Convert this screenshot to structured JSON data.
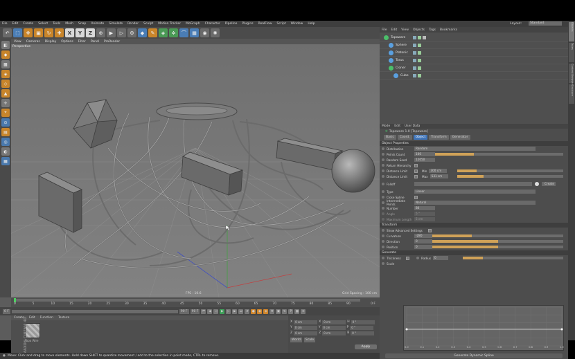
{
  "menubar": {
    "items": [
      "File",
      "Edit",
      "Create",
      "Select",
      "Tools",
      "Mesh",
      "Snap",
      "Animate",
      "Simulate",
      "Render",
      "Sculpt",
      "Motion Tracker",
      "MoGraph",
      "Character",
      "Pipeline",
      "Plugins",
      "RealFlow",
      "Script",
      "Window",
      "Help"
    ],
    "layout_label": "Layout:",
    "layout_value": "Standard"
  },
  "toolbar": {
    "icons": [
      "undo-icon",
      "select-icon",
      "move-icon",
      "scale-icon",
      "rotate-icon",
      "last-tool-icon",
      "x-axis-icon",
      "y-axis-icon",
      "z-axis-icon",
      "world-coord-icon",
      "render-view-icon",
      "render-pv-icon",
      "render-settings-icon",
      "cube-icon",
      "pen-icon",
      "subdivide-icon",
      "cloner-icon",
      "deformer-icon",
      "scene-icon",
      "camera-icon",
      "light-icon"
    ],
    "axis_labels": [
      "X",
      "Y",
      "Z"
    ]
  },
  "viewport": {
    "menu": [
      "View",
      "Cameras",
      "Display",
      "Options",
      "Filter",
      "Panel",
      "ProRender"
    ],
    "label": "Perspective",
    "fps": "FPS : 10.6",
    "grid_spacing": "Grid Spacing : 100 cm"
  },
  "timeline": {
    "ticks": [
      "0",
      "5",
      "10",
      "15",
      "20",
      "25",
      "30",
      "35",
      "40",
      "45",
      "50",
      "55",
      "60",
      "65",
      "70",
      "75",
      "80",
      "85",
      "90"
    ],
    "end_frame": "0 F",
    "start_field": "0 F",
    "end_field": "90 F",
    "max_field": "90 F"
  },
  "material_manager": {
    "menu": [
      "Create",
      "Edit",
      "Function",
      "Texture"
    ],
    "material_name": "Topo Wire",
    "logo": "MAXON CINEMA 4D"
  },
  "coordinates": {
    "rows": [
      {
        "a": "X",
        "b": "0 cm",
        "c": "X",
        "d": "0 cm",
        "e": "H",
        "f": "0 °"
      },
      {
        "a": "Y",
        "b": "0 cm",
        "c": "Y",
        "d": "0 cm",
        "e": "P",
        "f": "0 °"
      },
      {
        "a": "Z",
        "b": "0 cm",
        "c": "Z",
        "d": "0 cm",
        "e": "B",
        "f": "0 °"
      }
    ],
    "mode": "World",
    "scale_mode": "Scale",
    "apply": "Apply"
  },
  "status_text": "Move: Click and drag to move elements. Hold down SHIFT to quantize movement / add to the selection in point mode, CTRL to remove.",
  "object_manager": {
    "menu": [
      "File",
      "Edit",
      "View",
      "Objects",
      "Tags",
      "Bookmarks"
    ],
    "objects": [
      {
        "name": "Topoware",
        "indent": 0,
        "color": "#4bbf6a"
      },
      {
        "name": "Sphere",
        "indent": 1,
        "color": "#5aa0e0"
      },
      {
        "name": "Platonic",
        "indent": 1,
        "color": "#5aa0e0"
      },
      {
        "name": "Torus",
        "indent": 1,
        "color": "#5aa0e0"
      },
      {
        "name": "Cloner",
        "indent": 1,
        "color": "#4bbf6a"
      },
      {
        "name": "Cube",
        "indent": 2,
        "color": "#5aa0e0"
      }
    ]
  },
  "attributes": {
    "menu": [
      "Mode",
      "Edit",
      "User Data"
    ],
    "title": "Topoware 1.0 [Topoware]",
    "tabs": [
      "Basic",
      "Coord.",
      "Object",
      "Transform",
      "Generator"
    ],
    "active_tab": "Object",
    "sections": {
      "object_properties": "Object Properties",
      "transform": "Transform",
      "generate": "Generate"
    },
    "distribution_label": "Distribution",
    "distribution_value": "Random",
    "points_count_label": "Points Count",
    "points_count": "100",
    "points_count_fill": 0.3,
    "random_seed_label": "Random Seed",
    "random_seed": "12050",
    "return_hierarchy_label": "Return Hierarchy",
    "distance_limit_label": "Distance Limit",
    "min_label": "Min",
    "min_value": "300 cm",
    "min_fill": 0.18,
    "max_label": "Max",
    "max_value": "531 cm",
    "max_fill": 0.25,
    "falloff_label": "Falloff",
    "create_label": "Create",
    "type_label": "Type",
    "type_value": "Linear",
    "close_spline_label": "Close Spline",
    "intermediate_points_label": "Intermediate Points",
    "intermediate_points_value": "Natural",
    "number_label": "Number",
    "number_value": "80",
    "angle_label": "Angle",
    "angle_value": "5 °",
    "max_length_label": "Maximum Length",
    "max_length_value": "5 cm",
    "show_advanced_label": "Show Advanced Settings",
    "curvature_label": "Curvature",
    "curvature_value": "-280",
    "curvature_fill": 0.3,
    "direction_label": "Direction",
    "direction_value": "0",
    "direction_fill": 0.5,
    "position_label": "Position",
    "position_value": "0",
    "position_fill": 0.5,
    "thickness_label": "Thickness",
    "radius_label": "Radius",
    "radius_value": "0",
    "radius_fill": 0.2,
    "scale_label": "Scale",
    "graph_ticks": [
      "0.0",
      "0.1",
      "0.2",
      "0.3",
      "0.4",
      "0.5",
      "0.6",
      "0.7",
      "0.8",
      "0.9",
      "1.0"
    ],
    "generate_button": "Generate Dynamic Spline"
  },
  "right_tabs": [
    "Objects",
    "Takes",
    "Content Browser",
    "Structure"
  ]
}
